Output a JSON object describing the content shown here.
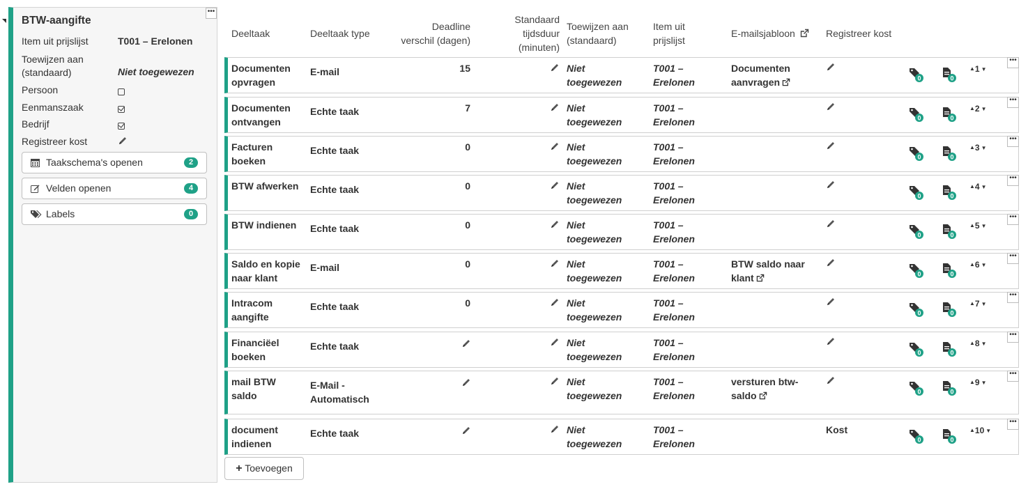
{
  "panel": {
    "title": "BTW-aangifte",
    "menu_glyph": "•••",
    "fields": [
      {
        "label": "Item uit prijslijst",
        "value": "T001 – Erelonen"
      },
      {
        "label": "Toewijzen aan (standaard)",
        "value": "Niet toegewezen"
      },
      {
        "label": "Persoon",
        "checked": false
      },
      {
        "label": "Eenmanszaak",
        "checked": true
      },
      {
        "label": "Bedrijf",
        "checked": true
      },
      {
        "label": "Registreer kost"
      }
    ],
    "buttons": [
      {
        "label": "Taakschema's openen",
        "count": "2",
        "icon": "calendar-icon"
      },
      {
        "label": "Velden openen",
        "count": "4",
        "icon": "edit-icon"
      },
      {
        "label": "Labels",
        "count": "0",
        "icon": "tags-icon"
      }
    ]
  },
  "table": {
    "headers": {
      "deeltaak": "Deeltaak",
      "type": "Deeltaak type",
      "deadline_1": "Deadline",
      "deadline_2": "verschil (dagen)",
      "duur_1": "Standaard",
      "duur_2": "tijdsduur",
      "duur_3": "(minuten)",
      "toewijzen_1": "Toewijzen aan",
      "toewijzen_2": "(standaard)",
      "item_1": "Item uit",
      "item_2": "prijslijst",
      "email": "E-mailsjabloon",
      "kost": "Registreer kost"
    },
    "rows": [
      {
        "name": [
          "Documenten",
          "opvragen"
        ],
        "type": [
          "E-mail"
        ],
        "deadline": "15",
        "assign": [
          "Niet",
          "toegewezen"
        ],
        "item": [
          "T001 –",
          "Erelonen"
        ],
        "email": [
          "Documenten",
          "aanvragen"
        ],
        "kost": "",
        "order": "1",
        "tag_count": "0",
        "doc_count": "0"
      },
      {
        "name": [
          "Documenten",
          "ontvangen"
        ],
        "type": [
          "Echte taak"
        ],
        "deadline": "7",
        "assign": [
          "Niet",
          "toegewezen"
        ],
        "item": [
          "T001 –",
          "Erelonen"
        ],
        "email": [],
        "kost": "",
        "order": "2",
        "tag_count": "0",
        "doc_count": "0"
      },
      {
        "name": [
          "Facturen",
          "boeken"
        ],
        "type": [
          "Echte taak"
        ],
        "deadline": "0",
        "assign": [
          "Niet",
          "toegewezen"
        ],
        "item": [
          "T001 –",
          "Erelonen"
        ],
        "email": [],
        "kost": "",
        "order": "3",
        "tag_count": "0",
        "doc_count": "0"
      },
      {
        "name": [
          "BTW afwerken"
        ],
        "type": [
          "Echte taak"
        ],
        "deadline": "0",
        "assign": [
          "Niet",
          "toegewezen"
        ],
        "item": [
          "T001 –",
          "Erelonen"
        ],
        "email": [],
        "kost": "",
        "order": "4",
        "tag_count": "0",
        "doc_count": "0"
      },
      {
        "name": [
          "BTW indienen"
        ],
        "type": [
          "Echte taak"
        ],
        "deadline": "0",
        "assign": [
          "Niet",
          "toegewezen"
        ],
        "item": [
          "T001 –",
          "Erelonen"
        ],
        "email": [],
        "kost": "",
        "order": "5",
        "tag_count": "0",
        "doc_count": "0"
      },
      {
        "name": [
          "Saldo en kopie",
          "naar klant"
        ],
        "type": [
          "E-mail"
        ],
        "deadline": "0",
        "assign": [
          "Niet",
          "toegewezen"
        ],
        "item": [
          "T001 –",
          "Erelonen"
        ],
        "email": [
          "BTW saldo naar",
          "klant"
        ],
        "kost": "",
        "order": "6",
        "tag_count": "0",
        "doc_count": "0"
      },
      {
        "name": [
          "Intracom",
          "aangifte"
        ],
        "type": [
          "Echte taak"
        ],
        "deadline": "0",
        "assign": [
          "Niet",
          "toegewezen"
        ],
        "item": [
          "T001 –",
          "Erelonen"
        ],
        "email": [],
        "kost": "",
        "order": "7",
        "tag_count": "0",
        "doc_count": "0"
      },
      {
        "name": [
          "Financiëel",
          "boeken"
        ],
        "type": [
          "Echte taak"
        ],
        "deadline": "",
        "assign": [
          "Niet",
          "toegewezen"
        ],
        "item": [
          "T001 –",
          "Erelonen"
        ],
        "email": [],
        "kost": "",
        "order": "8",
        "tag_count": "0",
        "doc_count": "0"
      },
      {
        "name": [
          "mail BTW",
          "saldo"
        ],
        "type": [
          "E-Mail -",
          "Automatisch"
        ],
        "deadline": "",
        "assign": [
          "Niet",
          "toegewezen"
        ],
        "item": [
          "T001 –",
          "Erelonen"
        ],
        "email": [
          "versturen btw-",
          "saldo"
        ],
        "kost": "",
        "order": "9",
        "tag_count": "0",
        "doc_count": "0"
      },
      {
        "name": [
          "document",
          "indienen"
        ],
        "type": [
          "Echte taak"
        ],
        "deadline": "",
        "assign": [
          "Niet",
          "toegewezen"
        ],
        "item": [
          "T001 –",
          "Erelonen"
        ],
        "email": [],
        "kost": "Kost",
        "order": "10",
        "tag_count": "0",
        "doc_count": "0"
      }
    ]
  },
  "add_button": {
    "label": "Toevoegen"
  },
  "colors": {
    "accent": "#1fa187"
  }
}
